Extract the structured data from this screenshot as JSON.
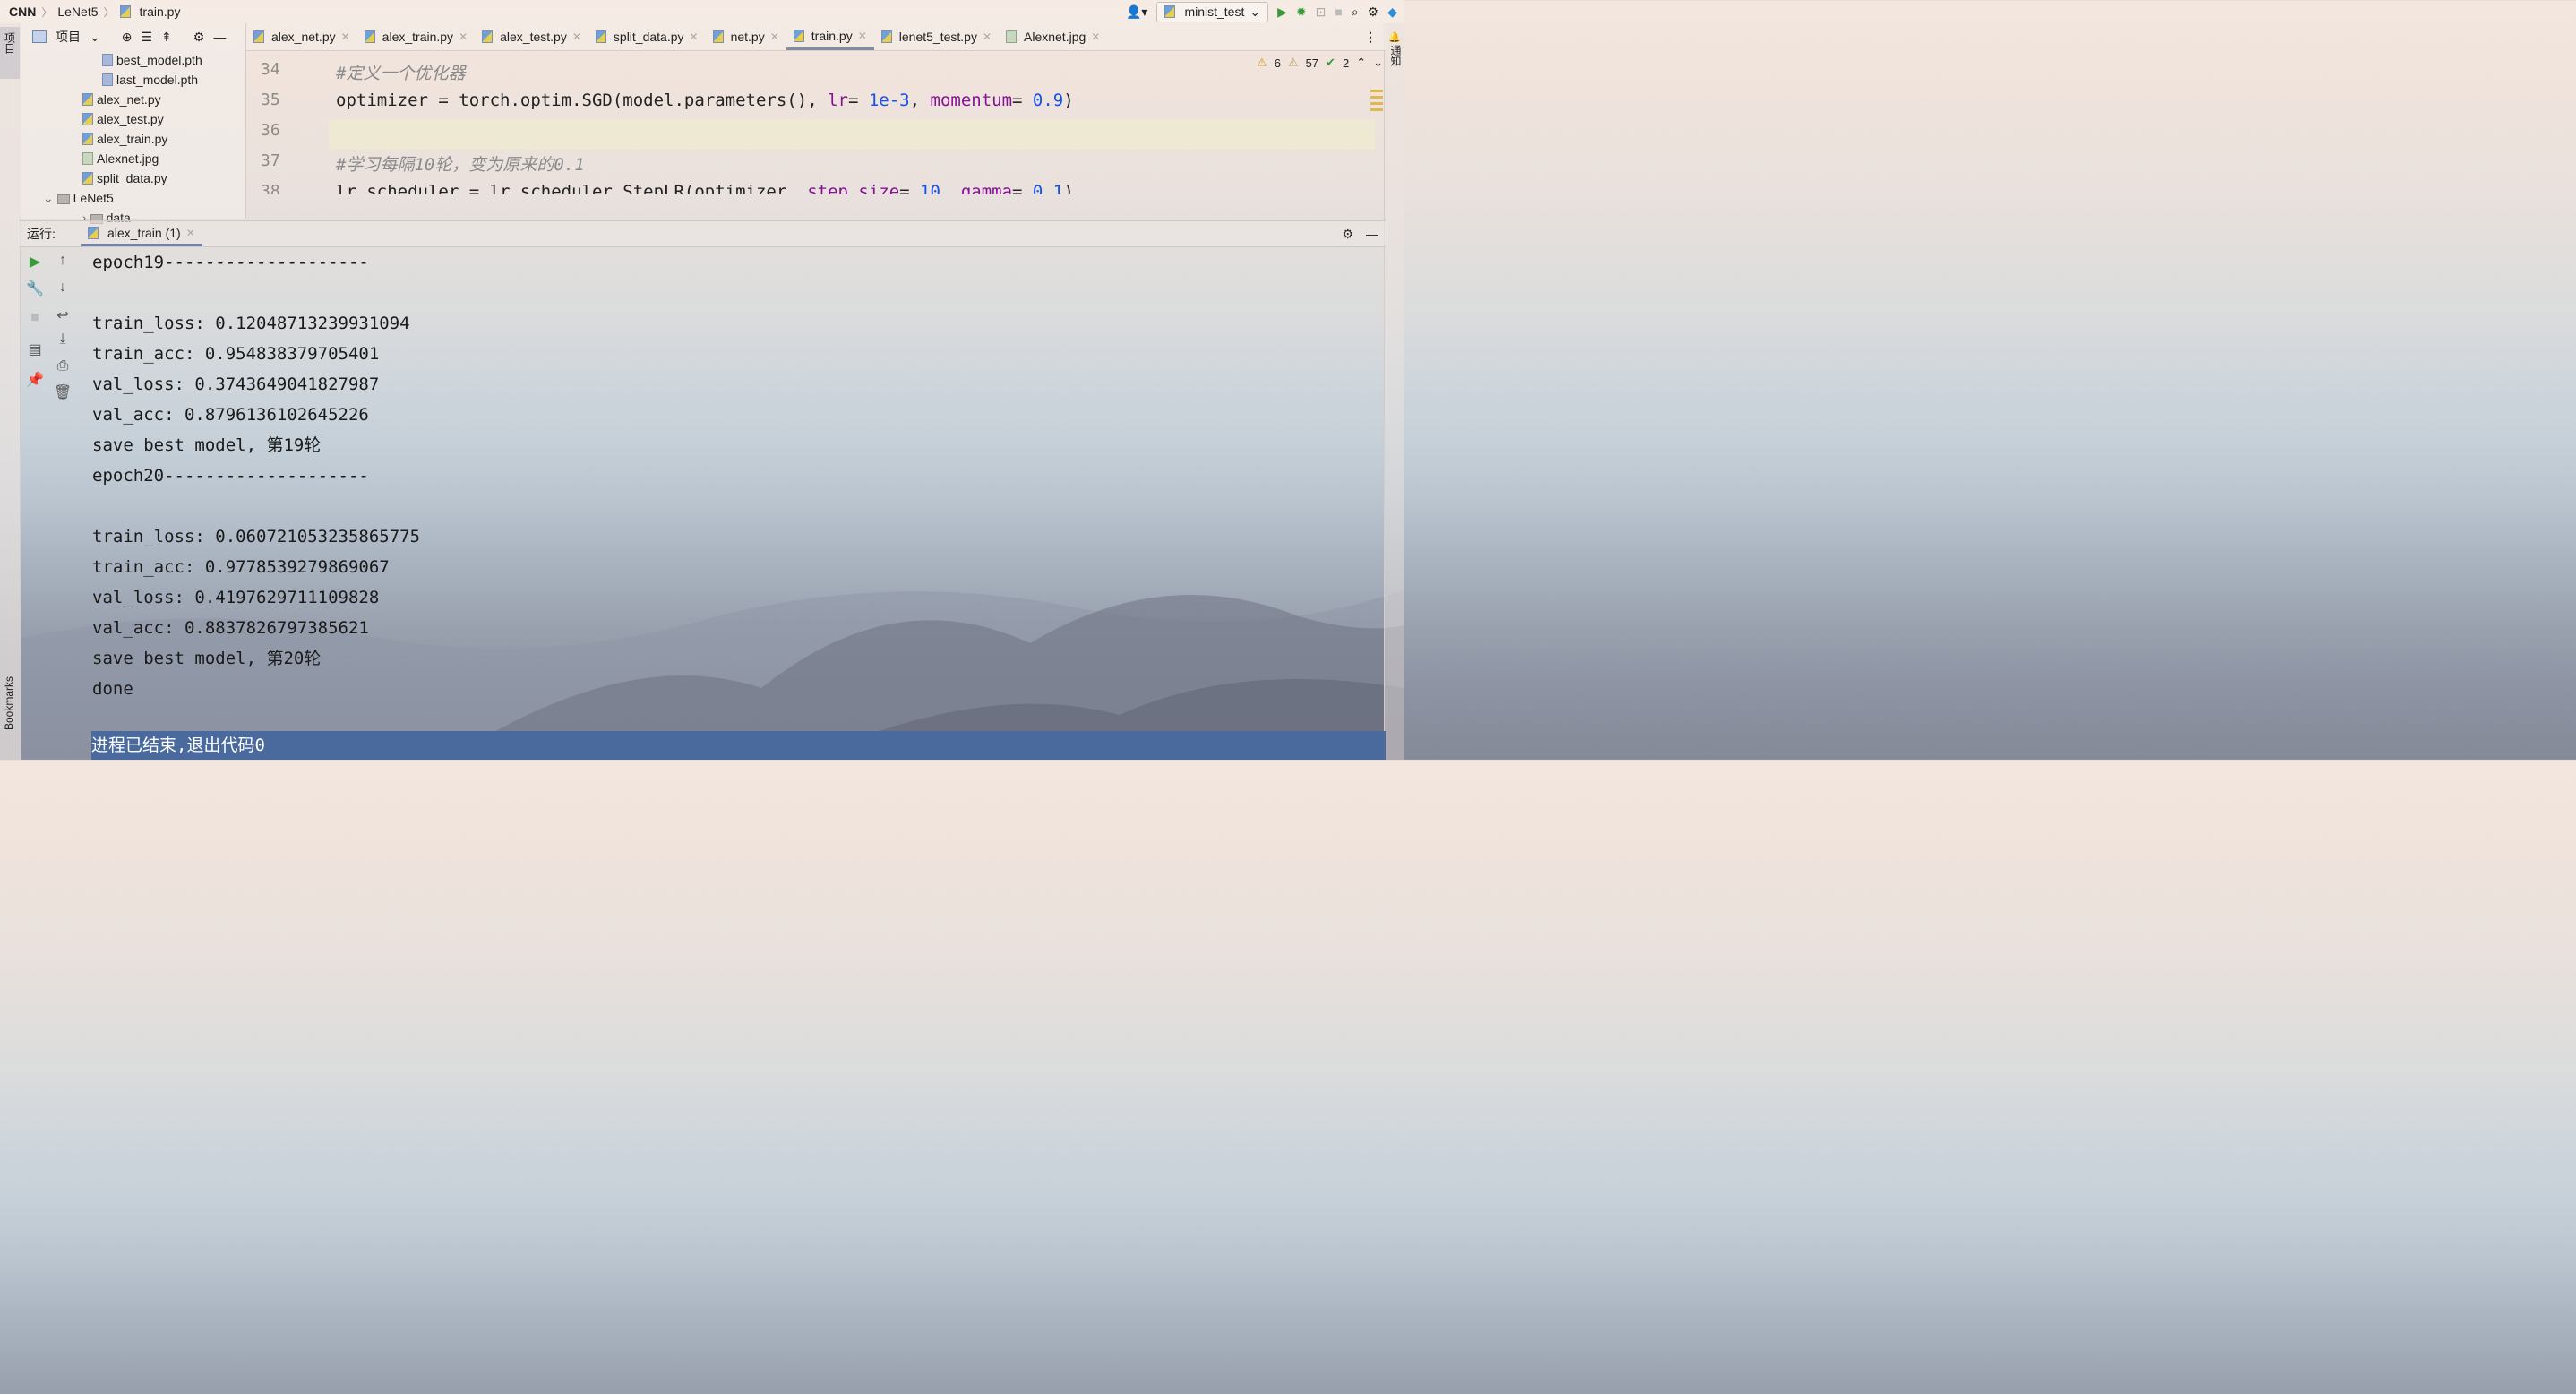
{
  "breadcrumb": {
    "project": "CNN",
    "folder": "LeNet5",
    "file": "train.py"
  },
  "run_config": {
    "name": "minist_test"
  },
  "left_strip": {
    "project_tab": "项目",
    "bookmarks_tab": "Bookmarks"
  },
  "right_strip": {
    "notifications_tab": "通知"
  },
  "project_panel": {
    "title": "项目",
    "tree": [
      {
        "label": "best_model.pth",
        "indent": 3,
        "kind": "file"
      },
      {
        "label": "last_model.pth",
        "indent": 3,
        "kind": "file"
      },
      {
        "label": "alex_net.py",
        "indent": 2,
        "kind": "py"
      },
      {
        "label": "alex_test.py",
        "indent": 2,
        "kind": "py"
      },
      {
        "label": "alex_train.py",
        "indent": 2,
        "kind": "py"
      },
      {
        "label": "Alexnet.jpg",
        "indent": 2,
        "kind": "img"
      },
      {
        "label": "split_data.py",
        "indent": 2,
        "kind": "py"
      },
      {
        "label": "LeNet5",
        "indent": 1,
        "kind": "dir-open"
      },
      {
        "label": "data",
        "indent": 2,
        "kind": "dir"
      }
    ]
  },
  "editor_tabs": [
    {
      "label": "alex_net.py",
      "active": false,
      "closable": true
    },
    {
      "label": "alex_train.py",
      "active": false,
      "closable": true
    },
    {
      "label": "alex_test.py",
      "active": false,
      "closable": true
    },
    {
      "label": "split_data.py",
      "active": false,
      "closable": true
    },
    {
      "label": "net.py",
      "active": false,
      "closable": true
    },
    {
      "label": "train.py",
      "active": true,
      "closable": true
    },
    {
      "label": "lenet5_test.py",
      "active": false,
      "closable": true
    },
    {
      "label": "Alexnet.jpg",
      "active": false,
      "closable": true
    }
  ],
  "inspections": {
    "warnings": "6",
    "weak_warnings": "57",
    "typos": "2"
  },
  "editor": {
    "lines": [
      {
        "num": "34",
        "text": "#定义一个优化器"
      },
      {
        "num": "35",
        "text": "optimizer = torch.optim.SGD(model.parameters(), lr= 1e-3, momentum= 0.9)"
      },
      {
        "num": "36",
        "text": ""
      },
      {
        "num": "37",
        "text": "#学习每隔10轮，变为原来的0.1"
      },
      {
        "num": "38",
        "text": "lr_scheduler = lr_scheduler.StepLR(optimizer, step_size= 10, gamma= 0.1)"
      }
    ]
  },
  "run_panel": {
    "label": "运行:",
    "tab": "alex_train (1)",
    "output": [
      "epoch19--------------------",
      "",
      "train_loss: 0.12048713239931094",
      "train_acc: 0.954838379705401",
      "val_loss: 0.3743649041827987",
      "val_acc: 0.8796136102645226",
      "save best model, 第19轮",
      "epoch20--------------------",
      "",
      "train_loss: 0.060721053235865775",
      "train_acc: 0.9778539279869067",
      "val_loss: 0.4197629711109828",
      "val_acc: 0.8837826797385621",
      "save best model, 第20轮",
      "done"
    ],
    "exit_message": "进程已结束,退出代码0"
  }
}
